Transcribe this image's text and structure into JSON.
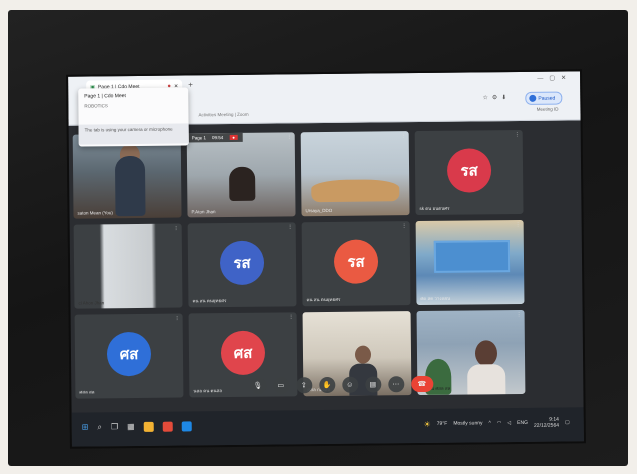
{
  "browser": {
    "tab_title": "Page 1 | Cdo Meet",
    "status_paused": "Paused",
    "toolbar_right_text": "Meeting ID",
    "mid_text": "Activities  Meeting | Zoom"
  },
  "popup": {
    "title": "Page 1 | Cdo Meet",
    "subtitle": "ROBOTICS",
    "notice": "The tab is using your camera or microphone"
  },
  "header_bar": {
    "page_label": "Page 1",
    "time": "09:54",
    "rec_label": "●"
  },
  "tiles": [
    {
      "name": "saton Mean (You)"
    },
    {
      "name": "P.Aton Jhan"
    },
    {
      "name": "Ursaya_DDO"
    },
    {
      "name": "sk ตน อนตนศร",
      "avatar": "รส",
      "color": "#d93a4b"
    },
    {
      "name": "cl Ahon Jhan"
    },
    {
      "name": "คน สน ตนยุทธศร",
      "avatar": "รส",
      "color": "#3f63c7"
    },
    {
      "name": "คน สน ตนยุทธศร",
      "avatar": "รส",
      "color": "#ea5a42"
    },
    {
      "name": "ศด สด วางแผน"
    },
    {
      "name": "ศสล สล",
      "avatar": "ศส",
      "color": "#2f6fd8"
    },
    {
      "name": "นสล คน ตนสล",
      "avatar": "ศส",
      "color": "#e0454c"
    },
    {
      "name": "ศสล กลงสล"
    },
    {
      "name": "ศสล น ศสล สล"
    }
  ],
  "controls": [
    "mic",
    "cam",
    "present",
    "hand",
    "reactions",
    "more",
    "end"
  ],
  "taskbar": {
    "weather_temp": "79°F",
    "weather_text": "Mostly sunny",
    "lang": "ENG",
    "time": "9:14",
    "date": "22/12/2564"
  }
}
